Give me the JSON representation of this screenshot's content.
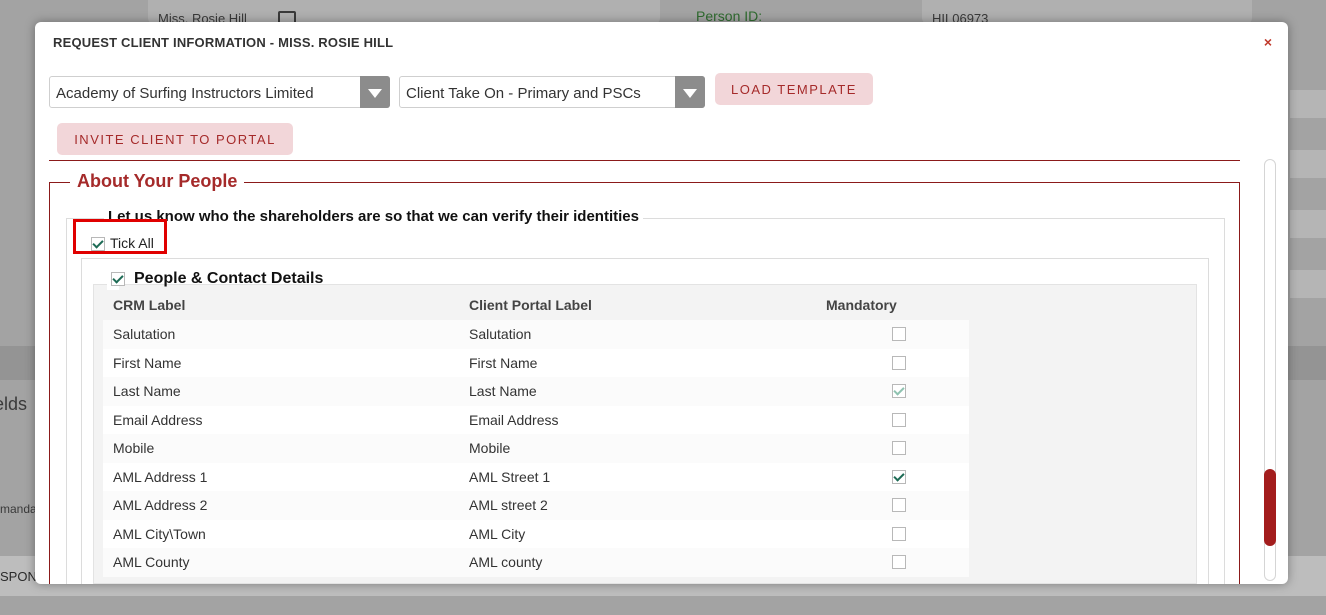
{
  "background": {
    "client_name": "Miss. Rosie Hill",
    "person_id_label": "Person ID:",
    "person_id_value": "HIL06973",
    "fields_fragment": "elds",
    "mandatory_fragment": "manda",
    "response_fragment": "SPON"
  },
  "modal": {
    "title": "REQUEST CLIENT INFORMATION - MISS. ROSIE HILL",
    "close_label": "×",
    "company_select": "Academy of Surfing Instructors Limited",
    "template_select": "Client Take On - Primary and PSCs",
    "load_template_label": "LOAD TEMPLATE",
    "invite_label": "INVITE CLIENT TO PORTAL",
    "section_title": "About Your People",
    "subsection_title": "Let us know who the shareholders are so that we can verify their identities",
    "tick_all_label": "Tick All",
    "tick_all_checked": true,
    "group_title": "People & Contact Details",
    "group_checked": true,
    "table": {
      "headers": [
        "CRM Label",
        "Client Portal Label",
        "Mandatory"
      ],
      "rows": [
        {
          "crm": "Salutation",
          "portal": "Salutation",
          "mandatory": false,
          "disabled": false
        },
        {
          "crm": "First Name",
          "portal": "First Name",
          "mandatory": false,
          "disabled": false
        },
        {
          "crm": "Last Name",
          "portal": "Last Name",
          "mandatory": true,
          "disabled": true
        },
        {
          "crm": "Email Address",
          "portal": "Email Address",
          "mandatory": false,
          "disabled": false
        },
        {
          "crm": "Mobile",
          "portal": "Mobile",
          "mandatory": false,
          "disabled": false
        },
        {
          "crm": "AML Address 1",
          "portal": "AML Street 1",
          "mandatory": true,
          "disabled": false
        },
        {
          "crm": "AML Address 2",
          "portal": "AML street 2",
          "mandatory": false,
          "disabled": false
        },
        {
          "crm": "AML City\\Town",
          "portal": "AML City",
          "mandatory": false,
          "disabled": false
        },
        {
          "crm": "AML County",
          "portal": "AML county",
          "mandatory": false,
          "disabled": false
        }
      ]
    }
  },
  "colors": {
    "accent": "#a52a2a",
    "button_bg": "#f2d6d9",
    "scroll_thumb": "#a31d1d",
    "check": "#1d6b55",
    "highlight": "#e00000"
  }
}
